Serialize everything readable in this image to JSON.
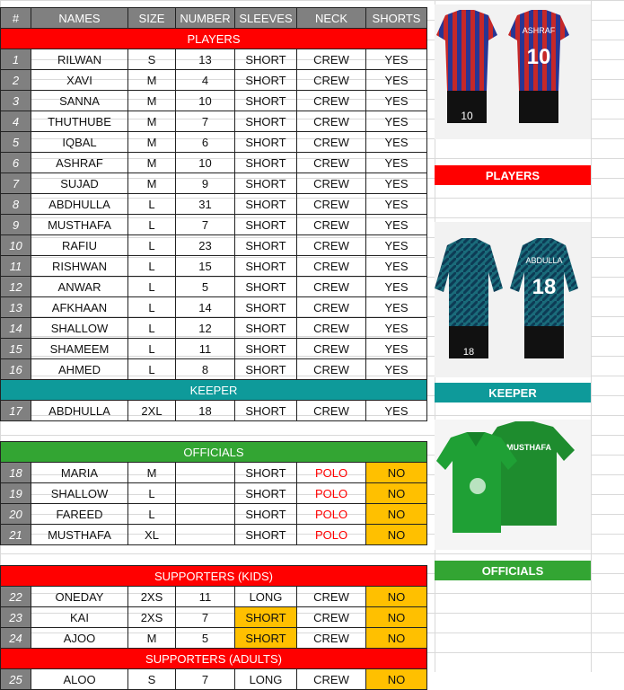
{
  "headers": [
    "#",
    "NAMES",
    "SIZE",
    "NUMBER",
    "SLEEVES",
    "NECK",
    "SHORTS"
  ],
  "sections": {
    "players": "PLAYERS",
    "keeper": "KEEPER",
    "officials": "OFFICIALS",
    "supporters_kids": "SUPPORTERS (KIDS)",
    "supporters_adults": "SUPPORTERS (ADULTS)"
  },
  "players": [
    {
      "n": "1",
      "name": "RILWAN",
      "size": "S",
      "number": "13",
      "sleeves": "SHORT",
      "neck": "CREW",
      "shorts": "YES"
    },
    {
      "n": "2",
      "name": "XAVI",
      "size": "M",
      "number": "4",
      "sleeves": "SHORT",
      "neck": "CREW",
      "shorts": "YES"
    },
    {
      "n": "3",
      "name": "SANNA",
      "size": "M",
      "number": "10",
      "sleeves": "SHORT",
      "neck": "CREW",
      "shorts": "YES"
    },
    {
      "n": "4",
      "name": "THUTHUBE",
      "size": "M",
      "number": "7",
      "sleeves": "SHORT",
      "neck": "CREW",
      "shorts": "YES"
    },
    {
      "n": "5",
      "name": "IQBAL",
      "size": "M",
      "number": "6",
      "sleeves": "SHORT",
      "neck": "CREW",
      "shorts": "YES"
    },
    {
      "n": "6",
      "name": "ASHRAF",
      "size": "M",
      "number": "10",
      "sleeves": "SHORT",
      "neck": "CREW",
      "shorts": "YES"
    },
    {
      "n": "7",
      "name": "SUJAD",
      "size": "M",
      "number": "9",
      "sleeves": "SHORT",
      "neck": "CREW",
      "shorts": "YES"
    },
    {
      "n": "8",
      "name": "ABDHULLA",
      "size": "L",
      "number": "31",
      "sleeves": "SHORT",
      "neck": "CREW",
      "shorts": "YES"
    },
    {
      "n": "9",
      "name": "MUSTHAFA",
      "size": "L",
      "number": "7",
      "sleeves": "SHORT",
      "neck": "CREW",
      "shorts": "YES"
    },
    {
      "n": "10",
      "name": "RAFIU",
      "size": "L",
      "number": "23",
      "sleeves": "SHORT",
      "neck": "CREW",
      "shorts": "YES"
    },
    {
      "n": "11",
      "name": "RISHWAN",
      "size": "L",
      "number": "15",
      "sleeves": "SHORT",
      "neck": "CREW",
      "shorts": "YES"
    },
    {
      "n": "12",
      "name": "ANWAR",
      "size": "L",
      "number": "5",
      "sleeves": "SHORT",
      "neck": "CREW",
      "shorts": "YES"
    },
    {
      "n": "13",
      "name": "AFKHAAN",
      "size": "L",
      "number": "14",
      "sleeves": "SHORT",
      "neck": "CREW",
      "shorts": "YES"
    },
    {
      "n": "14",
      "name": "SHALLOW",
      "size": "L",
      "number": "12",
      "sleeves": "SHORT",
      "neck": "CREW",
      "shorts": "YES"
    },
    {
      "n": "15",
      "name": "SHAMEEM",
      "size": "L",
      "number": "11",
      "sleeves": "SHORT",
      "neck": "CREW",
      "shorts": "YES"
    },
    {
      "n": "16",
      "name": "AHMED",
      "size": "L",
      "number": "8",
      "sleeves": "SHORT",
      "neck": "CREW",
      "shorts": "YES"
    }
  ],
  "keeper": [
    {
      "n": "17",
      "name": "ABDHULLA",
      "size": "2XL",
      "number": "18",
      "sleeves": "SHORT",
      "neck": "CREW",
      "shorts": "YES"
    }
  ],
  "officials": [
    {
      "n": "18",
      "name": "MARIA",
      "size": "M",
      "number": "",
      "sleeves": "SHORT",
      "neck": "POLO",
      "shorts": "NO"
    },
    {
      "n": "19",
      "name": "SHALLOW",
      "size": "L",
      "number": "",
      "sleeves": "SHORT",
      "neck": "POLO",
      "shorts": "NO"
    },
    {
      "n": "20",
      "name": "FAREED",
      "size": "L",
      "number": "",
      "sleeves": "SHORT",
      "neck": "POLO",
      "shorts": "NO"
    },
    {
      "n": "21",
      "name": "MUSTHAFA",
      "size": "XL",
      "number": "",
      "sleeves": "SHORT",
      "neck": "POLO",
      "shorts": "NO"
    }
  ],
  "supporters_kids": [
    {
      "n": "22",
      "name": "ONEDAY",
      "size": "2XS",
      "number": "11",
      "sleeves": "LONG",
      "neck": "CREW",
      "shorts": "NO"
    },
    {
      "n": "23",
      "name": "KAI",
      "size": "2XS",
      "number": "7",
      "sleeves": "SHORT",
      "neck": "CREW",
      "shorts": "NO"
    },
    {
      "n": "24",
      "name": "AJOO",
      "size": "M",
      "number": "5",
      "sleeves": "SHORT",
      "neck": "CREW",
      "shorts": "NO"
    }
  ],
  "supporters_adults": [
    {
      "n": "25",
      "name": "ALOO",
      "size": "S",
      "number": "7",
      "sleeves": "LONG",
      "neck": "CREW",
      "shorts": "NO"
    }
  ],
  "side_labels": {
    "players": "PLAYERS",
    "keeper": "KEEPER",
    "officials": "OFFICIALS"
  },
  "jersey_text": {
    "player_name": "ASHRAF",
    "player_number": "10",
    "front_number": "10",
    "keeper_name": "ABDULLA",
    "keeper_number": "18",
    "keeper_front_number": "18",
    "official_name": "MUSTHAFA"
  },
  "colors": {
    "players": "#ff0000",
    "keeper": "#0e9a9a",
    "officials": "#33a533",
    "highlight": "#ffc000",
    "header": "#808080"
  }
}
